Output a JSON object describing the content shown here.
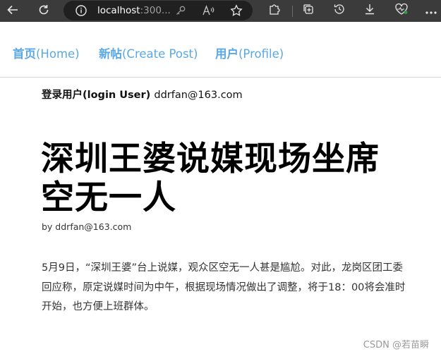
{
  "browser": {
    "url_host": "localhost",
    "url_rest": ":300..."
  },
  "nav": {
    "home_label": "首页",
    "home_en": "(Home)",
    "create_label": "新帖",
    "create_en": "(Create Post)",
    "profile_label": "用户",
    "profile_en": "(Profile)"
  },
  "user": {
    "login_label": "登录用户(login User)",
    "email": "ddrfan@163.com"
  },
  "post": {
    "title": "深圳王婆说媒现场坐席空无一人",
    "byline": "by ddrfan@163.com",
    "body": "5月9日，“深圳王婆”台上说媒，观众区空无一人甚是尴尬。对此，龙岗区团工委回应称，原定说媒时间为中午，根据现场情况做出了调整，将于18：00将会准时开始，也方便上班群体。"
  },
  "watermark": "CSDN @若苗瞬"
}
